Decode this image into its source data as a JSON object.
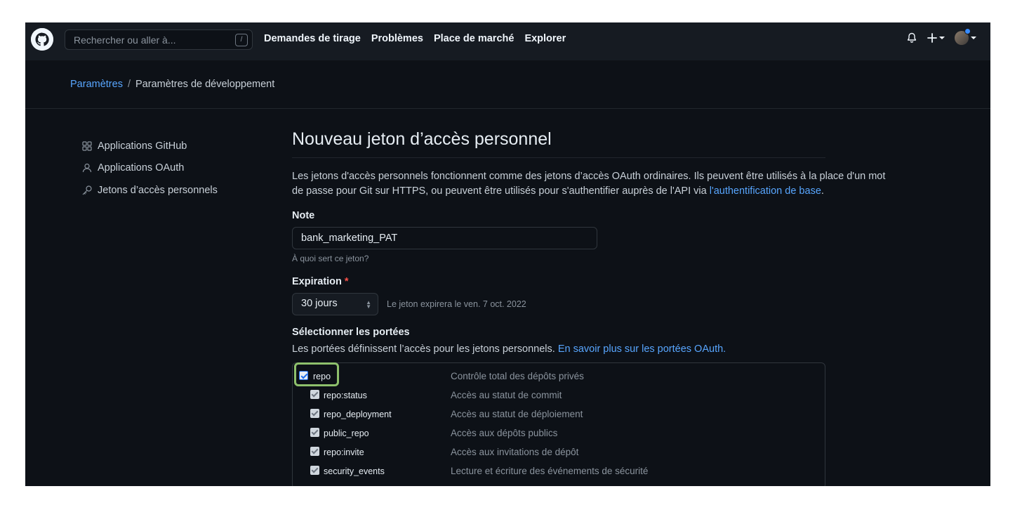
{
  "header": {
    "search_placeholder": "Rechercher ou aller à...",
    "search_shortcut": "/",
    "nav": [
      "Demandes de tirage",
      "Problèmes",
      "Place de marché",
      "Explorer"
    ]
  },
  "breadcrumb": {
    "parent": "Paramètres",
    "separator": "/",
    "current": "Paramètres de développement"
  },
  "sidebar": {
    "items": [
      {
        "label": "Applications GitHub",
        "icon": "apps-grid-icon"
      },
      {
        "label": "Applications OAuth",
        "icon": "person-icon"
      },
      {
        "label": "Jetons d’accès personnels",
        "icon": "key-icon"
      }
    ]
  },
  "main": {
    "title": "Nouveau jeton d’accès personnel",
    "description": "Les jetons d'accès personnels fonctionnent comme des jetons d’accès OAuth ordinaires. Ils peuvent être utilisés à la place d'un mot de passe pour Git sur HTTPS, ou peuvent être utilisés pour s'authentifier auprès de l'API via ",
    "description_link": "l'authentification de base",
    "description_end": ".",
    "note_label": "Note",
    "note_value": "bank_marketing_PAT",
    "note_hint": "À quoi sert ce jeton?",
    "expiration_label": "Expiration",
    "expiration_required": "*",
    "expiration_value": "30 jours",
    "expiration_note": "Le jeton expirera le ven. 7 oct. 2022",
    "scopes_label": "Sélectionner les portées",
    "scopes_desc": "Les portées définissent l’accès pour les jetons personnels. ",
    "scopes_link": "En savoir plus sur les portées OAuth."
  },
  "scopes": [
    {
      "name": "repo",
      "desc": "Contrôle total des dépôts privés",
      "checked": true
    },
    {
      "name": "repo:status",
      "desc": "Accès au statut de commit",
      "checked": true
    },
    {
      "name": "repo_deployment",
      "desc": "Accès au statut de déploiement",
      "checked": true
    },
    {
      "name": "public_repo",
      "desc": "Accès aux dépôts publics",
      "checked": true
    },
    {
      "name": "repo:invite",
      "desc": "Accès aux invitations de dépôt",
      "checked": true
    },
    {
      "name": "security_events",
      "desc": "Lecture et écriture des événements de sécurité",
      "checked": true
    }
  ],
  "colors": {
    "background": "#0d1117",
    "header": "#161b22",
    "link": "#58a6ff",
    "highlight": "#8ec06c"
  }
}
